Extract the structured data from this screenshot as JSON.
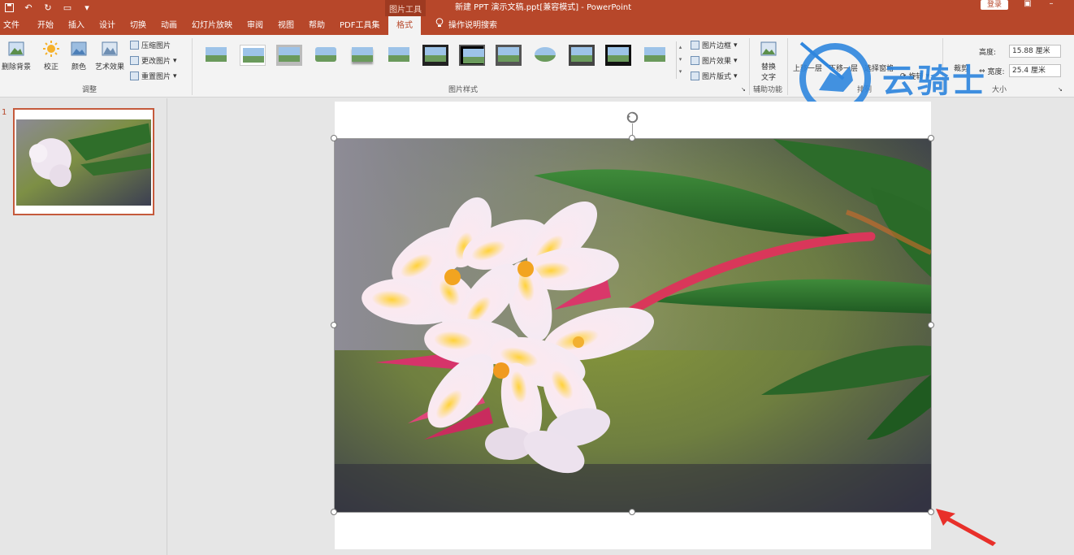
{
  "window": {
    "title": "新建 PPT 演示文稿.ppt[兼容模式] - PowerPoint",
    "context_tab": "图片工具",
    "login": "登录"
  },
  "menu": {
    "tabs": [
      "文件",
      "开始",
      "插入",
      "设计",
      "切换",
      "动画",
      "幻灯片放映",
      "审阅",
      "视图",
      "帮助",
      "PDF工具集"
    ],
    "active_tab": "格式",
    "search": "操作说明搜索"
  },
  "ribbon": {
    "adjust": {
      "label": "调整",
      "remove_bg": "删除背景",
      "correct": "校正",
      "color": "颜色",
      "art_effects": "艺术效果",
      "compress": "压缩图片",
      "change": "更改图片",
      "reset": "重置图片"
    },
    "styles": {
      "label": "图片样式",
      "border": "图片边框",
      "effects": "图片效果",
      "layout": "图片版式"
    },
    "accessibility": {
      "label": "辅助功能",
      "alt_text_1": "替换",
      "alt_text_2": "文字"
    },
    "arrange": {
      "label": "排列",
      "bring_forward": "上移一层",
      "send_backward": "下移一层",
      "selection_pane": "选择窗格",
      "rotate": "旋转"
    },
    "size": {
      "label": "大小",
      "crop": "裁剪",
      "height_label": "高度:",
      "height_value": "15.88 厘米",
      "width_label": "宽度:",
      "width_value": "25.4 厘米"
    }
  },
  "watermark": {
    "text": "云骑士"
  },
  "slides_panel": {
    "slide_number": "1"
  },
  "colors": {
    "accent": "#b7472a",
    "watermark": "#2f86de",
    "arrow": "#e8302a"
  }
}
